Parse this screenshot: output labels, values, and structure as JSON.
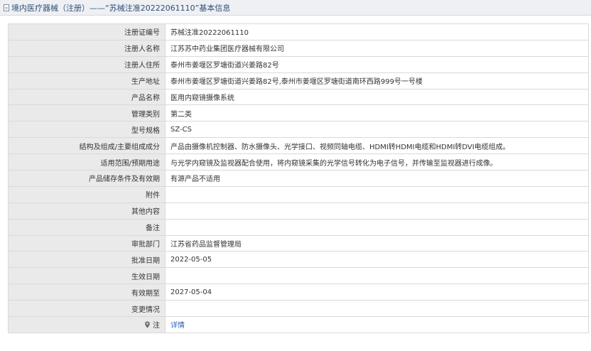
{
  "header": {
    "title": "境内医疗器械（注册）——“苏械注准20222061110”基本信息",
    "icon": "document-icon"
  },
  "rows": [
    {
      "label": "注册证编号",
      "value": "苏械注准20222061110"
    },
    {
      "label": "注册人名称",
      "value": "江苏苏中药业集团医疗器械有限公司"
    },
    {
      "label": "注册人住所",
      "value": "泰州市姜堰区罗塘街道兴姜路82号"
    },
    {
      "label": "生产地址",
      "value": "泰州市姜堰区罗塘街道兴姜路82号,泰州市姜堰区罗塘街道南环西路999号一号楼"
    },
    {
      "label": "产品名称",
      "value": "医用内窥镜摄像系统"
    },
    {
      "label": "管理类别",
      "value": "第二类"
    },
    {
      "label": "型号规格",
      "value": "SZ-CS"
    },
    {
      "label": "结构及组成/主要组成成分",
      "value": "产品由摄像机控制器、防水摄像头、光学接口、视频同轴电缆、HDMI转HDMI电缆和HDMI转DVI电缆组成。"
    },
    {
      "label": "适用范围/预期用途",
      "value": "与光学内窥镜及监视器配合使用，将内窥镜采集的光学信号转化为电子信号，并传输至监视器进行成像。"
    },
    {
      "label": "产品储存条件及有效期",
      "value": "有源产品不适用"
    },
    {
      "label": "附件",
      "value": ""
    },
    {
      "label": "其他内容",
      "value": ""
    },
    {
      "label": "备注",
      "value": ""
    },
    {
      "label": "审批部门",
      "value": "江苏省药品监督管理局"
    },
    {
      "label": "批准日期",
      "value": "2022-05-05"
    },
    {
      "label": "生效日期",
      "value": ""
    },
    {
      "label": "有效期至",
      "value": "2027-05-04"
    },
    {
      "label": "变更情况",
      "value": ""
    }
  ],
  "note": {
    "label": "注",
    "link_text": "详情",
    "icon": "pin-icon",
    "link_color": "#2a5fae"
  }
}
